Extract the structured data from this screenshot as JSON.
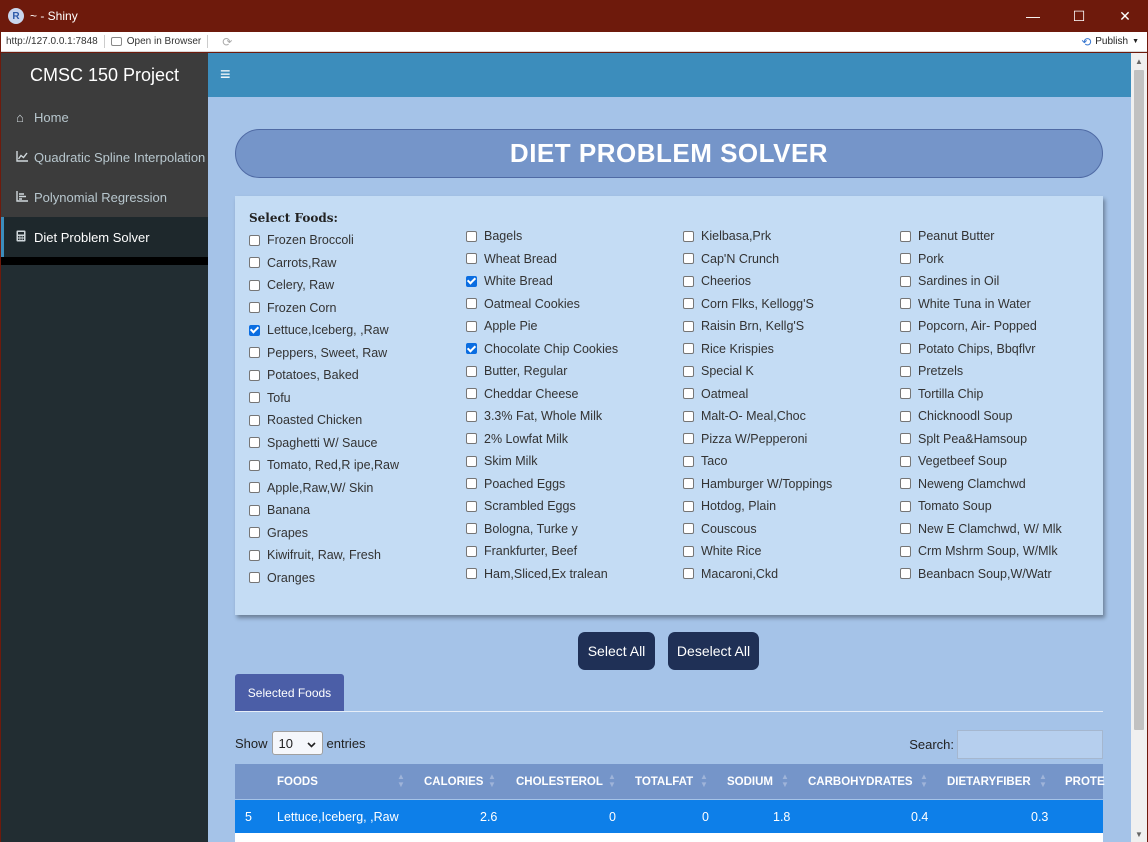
{
  "window": {
    "title": "~ - Shiny",
    "logo": "R",
    "minimize_glyph": "—",
    "maximize_glyph": "☐",
    "close_glyph": "✕"
  },
  "browser": {
    "url": "http://127.0.0.1:7848",
    "open_in_browser": "Open in Browser",
    "publish": "Publish"
  },
  "sidebar": {
    "brand": "CMSC 150 Project",
    "items": [
      {
        "label": "Home",
        "icon": "home-icon",
        "glyph": "⌂"
      },
      {
        "label": "Quadratic Spline Interpolation",
        "icon": "line-chart-icon",
        "glyph": "📈"
      },
      {
        "label": "Polynomial Regression",
        "icon": "bar-chart-icon",
        "glyph": "≡"
      },
      {
        "label": "Diet Problem Solver",
        "icon": "calculator-icon",
        "glyph": "▦"
      }
    ]
  },
  "header": {
    "menu_glyph": "≡"
  },
  "main": {
    "title": "DIET PROBLEM SOLVER",
    "select_label": "Select Foods:",
    "columns": [
      [
        {
          "label": "Frozen Broccoli",
          "checked": false
        },
        {
          "label": "Carrots,Raw",
          "checked": false
        },
        {
          "label": "Celery, Raw",
          "checked": false
        },
        {
          "label": "Frozen Corn",
          "checked": false
        },
        {
          "label": "Lettuce,Iceberg, ,Raw",
          "checked": true
        },
        {
          "label": "Peppers, Sweet, Raw",
          "checked": false
        },
        {
          "label": "Potatoes, Baked",
          "checked": false
        },
        {
          "label": "Tofu",
          "checked": false
        },
        {
          "label": "Roasted Chicken",
          "checked": false
        },
        {
          "label": "Spaghetti W/ Sauce",
          "checked": false
        },
        {
          "label": "Tomato, Red,R ipe,Raw",
          "checked": false
        },
        {
          "label": "Apple,Raw,W/ Skin",
          "checked": false
        },
        {
          "label": "Banana",
          "checked": false
        },
        {
          "label": "Grapes",
          "checked": false
        },
        {
          "label": "Kiwifruit, Raw, Fresh",
          "checked": false
        },
        {
          "label": "Oranges",
          "checked": false
        }
      ],
      [
        {
          "label": "Bagels",
          "checked": false
        },
        {
          "label": "Wheat Bread",
          "checked": false
        },
        {
          "label": "White Bread",
          "checked": true
        },
        {
          "label": "Oatmeal Cookies",
          "checked": false
        },
        {
          "label": "Apple Pie",
          "checked": false
        },
        {
          "label": "Chocolate Chip Cookies",
          "checked": true
        },
        {
          "label": "Butter, Regular",
          "checked": false
        },
        {
          "label": "Cheddar Cheese",
          "checked": false
        },
        {
          "label": "3.3% Fat, Whole Milk",
          "checked": false
        },
        {
          "label": "2% Lowfat Milk",
          "checked": false
        },
        {
          "label": "Skim Milk",
          "checked": false
        },
        {
          "label": "Poached Eggs",
          "checked": false
        },
        {
          "label": "Scrambled Eggs",
          "checked": false
        },
        {
          "label": "Bologna, Turke y",
          "checked": false
        },
        {
          "label": "Frankfurter, Beef",
          "checked": false
        },
        {
          "label": "Ham,Sliced,Ex tralean",
          "checked": false
        }
      ],
      [
        {
          "label": "Kielbasa,Prk",
          "checked": false
        },
        {
          "label": "Cap'N Crunch",
          "checked": false
        },
        {
          "label": "Cheerios",
          "checked": false
        },
        {
          "label": "Corn Flks, Kellogg'S",
          "checked": false
        },
        {
          "label": "Raisin Brn, Kellg'S",
          "checked": false
        },
        {
          "label": "Rice Krispies",
          "checked": false
        },
        {
          "label": "Special K",
          "checked": false
        },
        {
          "label": "Oatmeal",
          "checked": false
        },
        {
          "label": "Malt-O- Meal,Choc",
          "checked": false
        },
        {
          "label": "Pizza W/Pepperoni",
          "checked": false
        },
        {
          "label": "Taco",
          "checked": false
        },
        {
          "label": "Hamburger W/Toppings",
          "checked": false
        },
        {
          "label": "Hotdog, Plain",
          "checked": false
        },
        {
          "label": "Couscous",
          "checked": false
        },
        {
          "label": "White Rice",
          "checked": false
        },
        {
          "label": "Macaroni,Ckd",
          "checked": false
        }
      ],
      [
        {
          "label": "Peanut Butter",
          "checked": false
        },
        {
          "label": "Pork",
          "checked": false
        },
        {
          "label": "Sardines in Oil",
          "checked": false
        },
        {
          "label": "White Tuna in Water",
          "checked": false
        },
        {
          "label": "Popcorn, Air- Popped",
          "checked": false
        },
        {
          "label": "Potato Chips, Bbqflvr",
          "checked": false
        },
        {
          "label": "Pretzels",
          "checked": false
        },
        {
          "label": "Tortilla Chip",
          "checked": false
        },
        {
          "label": "Chicknoodl Soup",
          "checked": false
        },
        {
          "label": "Splt Pea&Hamsoup",
          "checked": false
        },
        {
          "label": "Vegetbeef Soup",
          "checked": false
        },
        {
          "label": "Neweng Clamchwd",
          "checked": false
        },
        {
          "label": "Tomato Soup",
          "checked": false
        },
        {
          "label": "New E Clamchwd, W/ Mlk",
          "checked": false
        },
        {
          "label": "Crm Mshrm Soup, W/Mlk",
          "checked": false
        },
        {
          "label": "Beanbacn Soup,W/Watr",
          "checked": false
        }
      ]
    ],
    "select_all": "Select All",
    "deselect_all": "Deselect All",
    "tab": "Selected Foods",
    "show": "Show",
    "entries_value": "10",
    "entries": "entries",
    "search_label": "Search:",
    "table": {
      "headers": [
        "",
        "FOODS",
        "CALORIES",
        "CHOLESTEROL",
        "TOTALFAT",
        "SODIUM",
        "CARBOHYDRATES",
        "DIETARYFIBER",
        "PROTE"
      ],
      "rows": [
        [
          "5",
          "Lettuce,Iceberg, ,Raw",
          "2.6",
          "0",
          "0",
          "1.8",
          "0.4",
          "0.3",
          ""
        ]
      ]
    }
  },
  "colors": {
    "titlebar": "#6e1a0c",
    "header": "#3c8dbc",
    "content_bg": "#a5c3e8",
    "panel": "#c4dcf4",
    "button": "#1f3056",
    "row_highlight": "#0d7fe9"
  }
}
